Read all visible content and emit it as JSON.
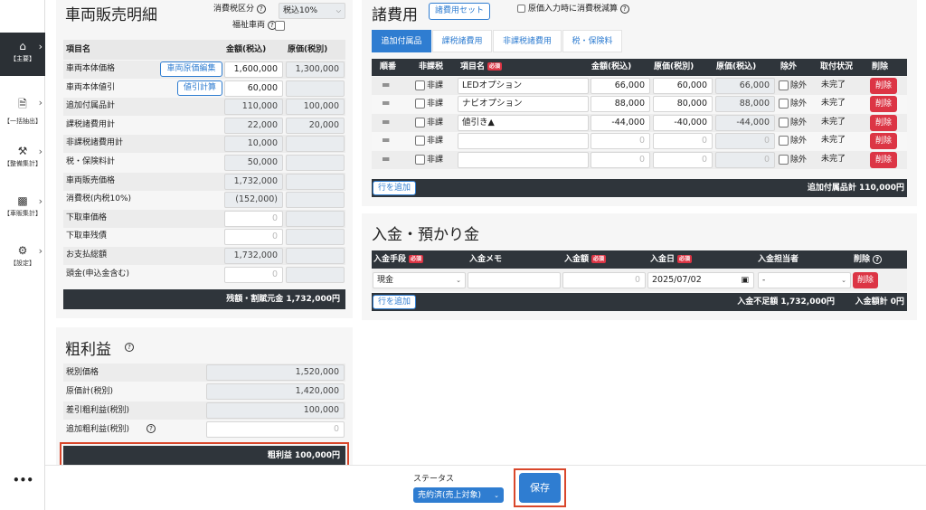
{
  "sidebar": {
    "items": [
      {
        "icon": "home-icon",
        "label": "【主要】"
      },
      {
        "icon": "file-export-icon",
        "label": "【一括抽出】"
      },
      {
        "icon": "car-wrench-icon",
        "label": "【整備集計】"
      },
      {
        "icon": "car-bed-icon",
        "label": "【車販集計】"
      },
      {
        "icon": "gear-icon",
        "label": "【設定】"
      }
    ],
    "more": "•••"
  },
  "vehicle": {
    "title": "車両販売明細",
    "tax_category_label": "消費税区分",
    "tax_category_value": "税込10%",
    "welfare_label": "福祉車両",
    "col_item": "項目名",
    "col_amount": "金額(税込)",
    "col_cost": "原価(税別)",
    "rows": [
      {
        "label": "車両本体価格",
        "button": "車両原価編集",
        "amount": "1,600,000",
        "cost": "1,300,000"
      },
      {
        "label": "車両本体値引",
        "button": "値引計算",
        "amount": "60,000",
        "cost": ""
      },
      {
        "label": "追加付属品計",
        "amount": "110,000",
        "cost": "100,000"
      },
      {
        "label": "課税諸費用計",
        "amount": "22,000",
        "cost": "20,000"
      },
      {
        "label": "非課税諸費用計",
        "amount": "10,000",
        "cost": ""
      },
      {
        "label": "税・保険料計",
        "amount": "50,000",
        "cost": ""
      },
      {
        "label": "車両販売価格",
        "amount": "1,732,000",
        "cost": ""
      },
      {
        "label": "消費税(内税10%)",
        "amount": "(152,000)",
        "cost": ""
      },
      {
        "label": "下取車価格",
        "amount": "0",
        "cost": ""
      },
      {
        "label": "下取車残債",
        "amount": "0",
        "cost": ""
      },
      {
        "label": "お支払総額",
        "amount": "1,732,000",
        "cost": ""
      },
      {
        "label": "頭金(申込金含む)",
        "amount": "0",
        "cost": ""
      }
    ],
    "footer": "残額・割賦元金 1,732,000円"
  },
  "profit": {
    "title": "粗利益",
    "rows": [
      {
        "label": "税別価格",
        "value": "1,520,000"
      },
      {
        "label": "原価計(税別)",
        "value": "1,420,000"
      },
      {
        "label": "差引粗利益(税別)",
        "value": "100,000"
      },
      {
        "label": "追加粗利益(税別)",
        "value": "0"
      }
    ],
    "footer": "粗利益 100,000円"
  },
  "fees": {
    "title": "諸費用",
    "set_button": "諸費用セット",
    "cost_tax_label": "原価入力時に消費税減算",
    "tabs": [
      "追加付属品",
      "課税諸費用",
      "非課税諸費用",
      "税・保険料"
    ],
    "cols": {
      "order": "順番",
      "nontax": "非課税",
      "name": "項目名",
      "required": "必須",
      "amount": "金額(税込)",
      "cost_ex": "原価(税別)",
      "cost_in": "原価(税込)",
      "exclude": "除外",
      "status": "取付状況",
      "delete": "削除"
    },
    "rows": [
      {
        "handle": "═",
        "nontax": "非課",
        "name": "LEDオプション",
        "amount": "66,000",
        "cost_ex": "60,000",
        "cost_in": "66,000",
        "exclude": "除外",
        "status": "未完了",
        "del": "削除"
      },
      {
        "handle": "═",
        "nontax": "非課",
        "name": "ナビオプション",
        "amount": "88,000",
        "cost_ex": "80,000",
        "cost_in": "88,000",
        "exclude": "除外",
        "status": "未完了",
        "del": "削除"
      },
      {
        "handle": "═",
        "nontax": "非課",
        "name": "値引き▲",
        "amount": "-44,000",
        "cost_ex": "-40,000",
        "cost_in": "-44,000",
        "exclude": "除外",
        "status": "未完了",
        "del": "削除"
      },
      {
        "handle": "═",
        "nontax": "非課",
        "name": "",
        "amount": "0",
        "cost_ex": "0",
        "cost_in": "0",
        "exclude": "除外",
        "status": "未完了",
        "del": "削除"
      },
      {
        "handle": "═",
        "nontax": "非課",
        "name": "",
        "amount": "0",
        "cost_ex": "0",
        "cost_in": "0",
        "exclude": "除外",
        "status": "未完了",
        "del": "削除"
      }
    ],
    "add_row": "行を追加",
    "total": "追加付属品計 110,000円"
  },
  "deposit": {
    "title": "入金・預かり金",
    "cols": {
      "method": "入金手段",
      "memo": "入金メモ",
      "amount": "入金額",
      "date": "入金日",
      "person": "入金担当者",
      "delete": "削除",
      "required": "必須"
    },
    "row": {
      "method": "現金",
      "memo": "",
      "amount": "0",
      "date": "2025/07/02",
      "person": "-",
      "del": "削除"
    },
    "add_row": "行を追加",
    "shortage": "入金不足額 1,732,000円",
    "total": "入金額計 0円"
  },
  "footer": {
    "status_label": "ステータス",
    "status_value": "売約済(売上対象)",
    "save": "保存"
  }
}
